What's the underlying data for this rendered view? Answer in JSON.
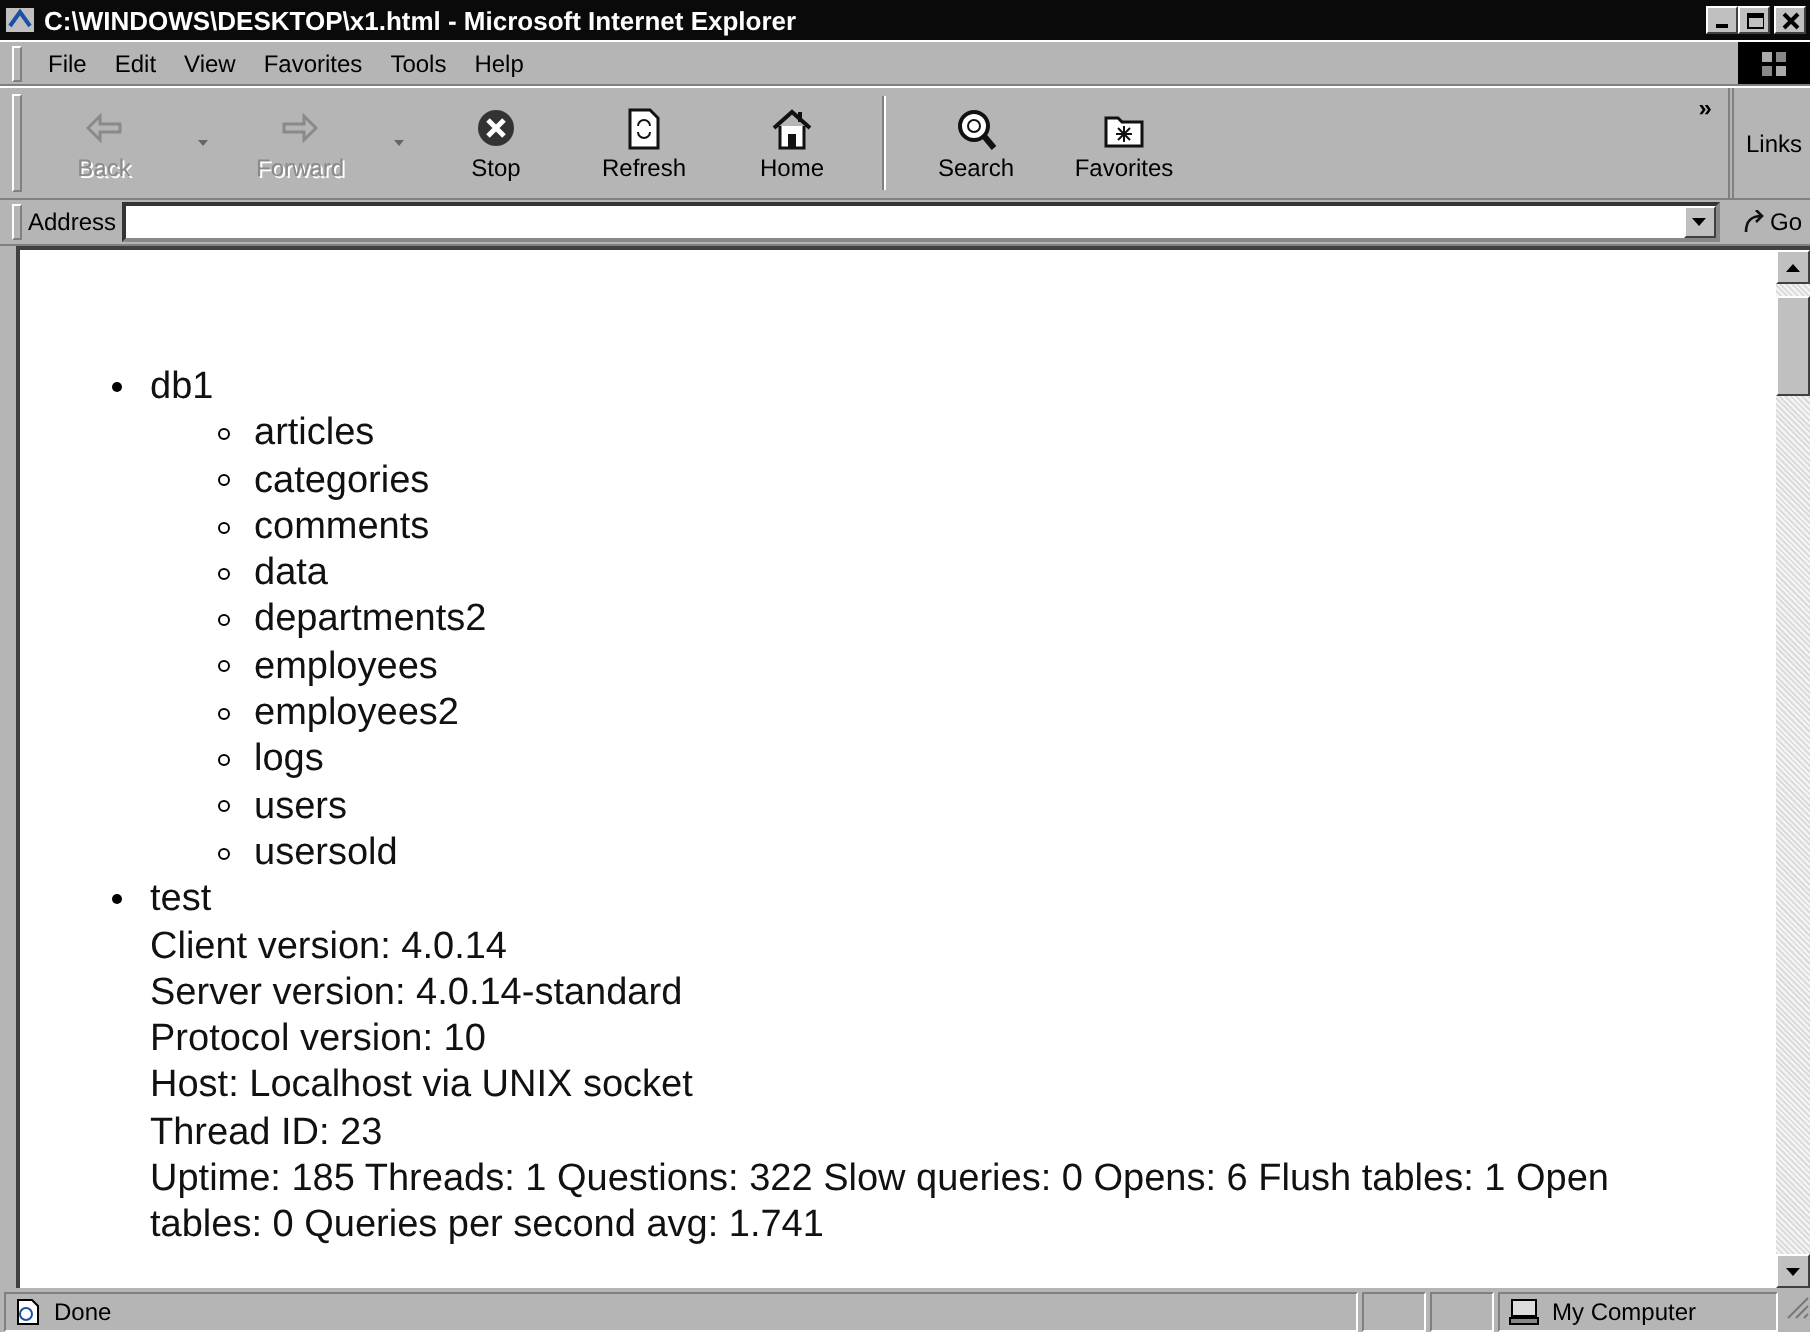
{
  "window": {
    "title": "C:\\WINDOWS\\DESKTOP\\x1.html - Microsoft Internet Explorer"
  },
  "menu": [
    "File",
    "Edit",
    "View",
    "Favorites",
    "Tools",
    "Help"
  ],
  "toolbar": [
    {
      "label": "Back",
      "kind": "back",
      "disabled": true,
      "dropdown": true
    },
    {
      "label": "Forward",
      "kind": "forward",
      "disabled": true,
      "dropdown": true
    },
    {
      "label": "Stop",
      "kind": "stop",
      "disabled": false,
      "dropdown": false
    },
    {
      "label": "Refresh",
      "kind": "refresh",
      "disabled": false,
      "dropdown": false
    },
    {
      "label": "Home",
      "kind": "home",
      "disabled": false,
      "dropdown": false
    },
    {
      "label": "Search",
      "kind": "search",
      "disabled": false,
      "dropdown": false
    },
    {
      "label": "Favorites",
      "kind": "favorites",
      "disabled": false,
      "dropdown": false
    }
  ],
  "toolbar_more": "»",
  "links": "Links",
  "address": {
    "label": "Address",
    "go": "Go"
  },
  "tree": [
    {
      "label": "db1",
      "children": [
        {
          "label": "articles"
        },
        {
          "label": "categories"
        },
        {
          "label": "comments"
        },
        {
          "label": "data"
        },
        {
          "label": "departments2"
        },
        {
          "label": "employees"
        },
        {
          "label": "employees2"
        },
        {
          "label": "logs"
        },
        {
          "label": "users"
        },
        {
          "label": "usersold"
        }
      ]
    },
    {
      "label": "test",
      "details": [
        "Client version: 4.0.14",
        "Server version: 4.0.14-standard",
        "Protocol version: 10",
        "Host: Localhost via UNIX socket",
        "Thread ID: 23",
        "Uptime: 185 Threads: 1 Questions: 322 Slow queries: 0 Opens: 6 Flush tables: 1 Open tables: 0 Queries per second avg: 1.741"
      ]
    }
  ],
  "status_bar": {
    "text": "Done",
    "zone": "My Computer"
  }
}
